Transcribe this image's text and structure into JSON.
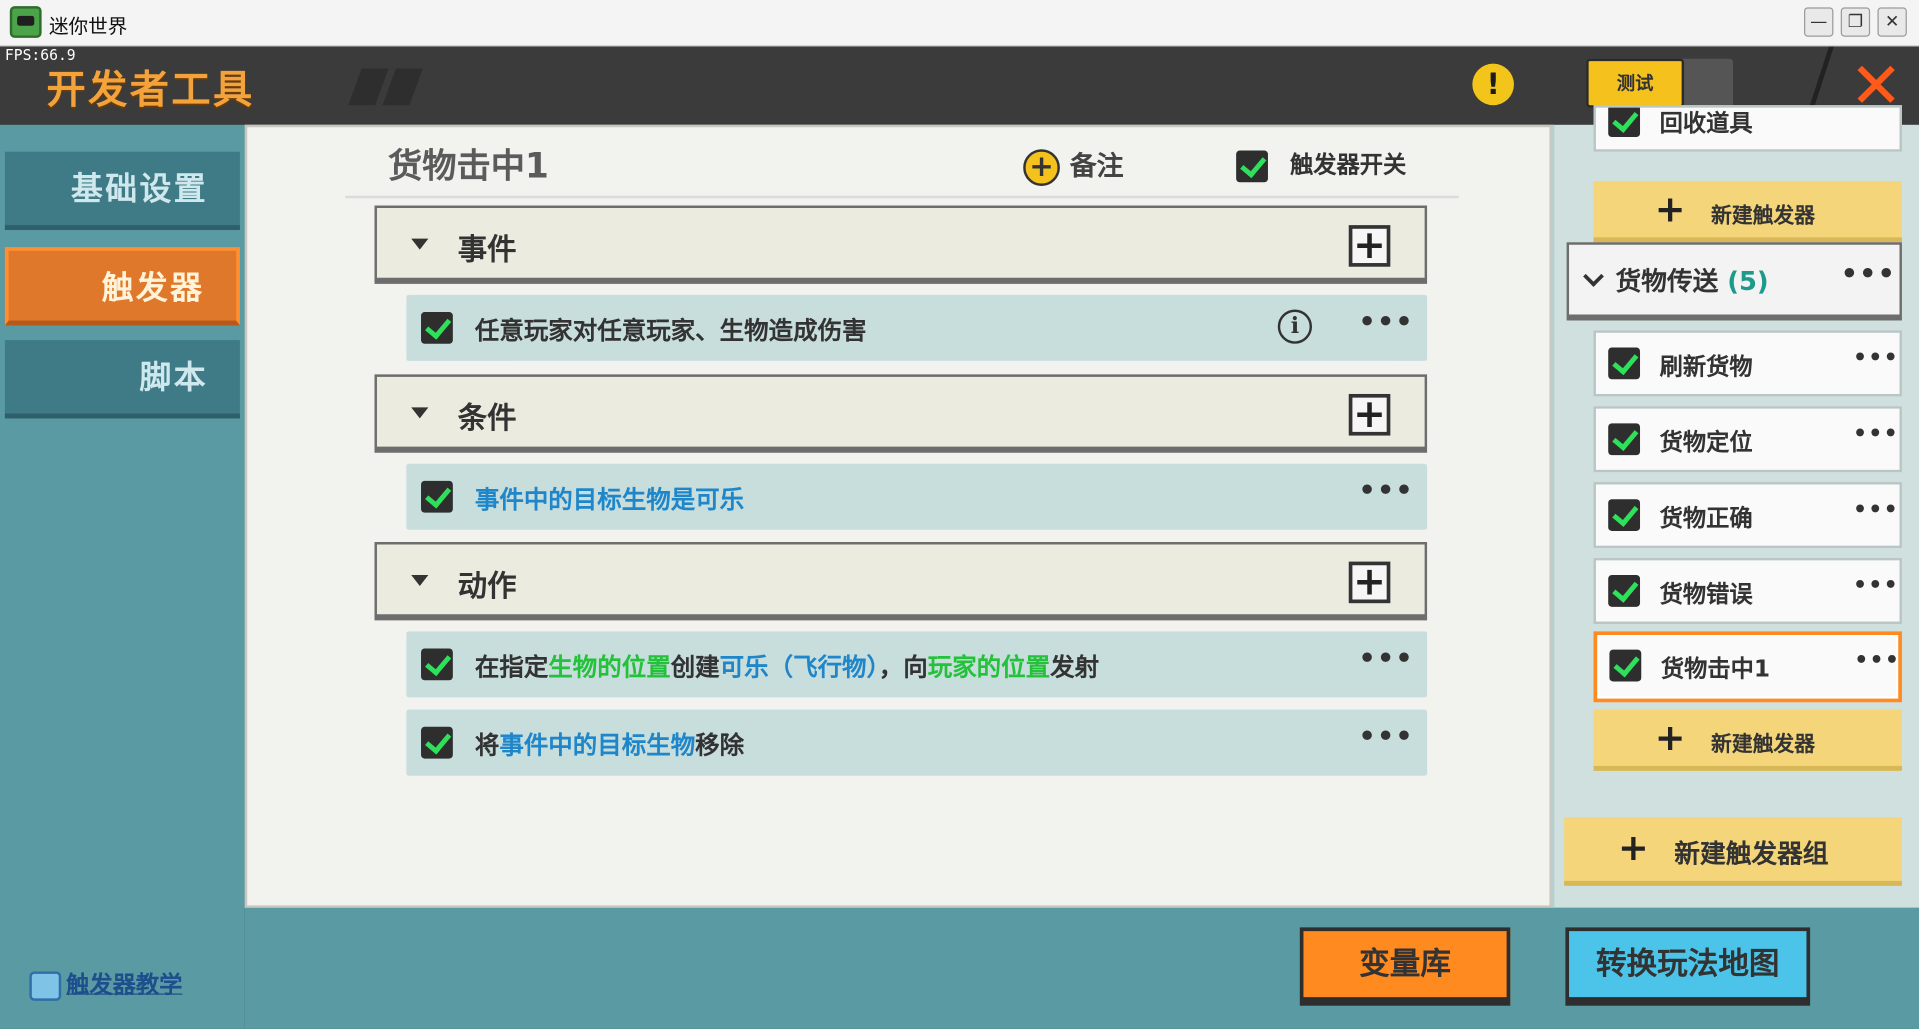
{
  "window": {
    "title": "迷你世界",
    "fps": "FPS:66.9",
    "btn_min": "—",
    "btn_max": "❐",
    "btn_close": "✕"
  },
  "header": {
    "title": "开发者工具",
    "warning_symbol": "!",
    "test_label": "测试",
    "close_symbol": "✕"
  },
  "sidebar": {
    "items": [
      {
        "label": "基础设置"
      },
      {
        "label": "触发器"
      },
      {
        "label": "脚本"
      }
    ],
    "help_link": "触发器教学"
  },
  "editor": {
    "trigger_name": "货物击中1",
    "note_label": "备注",
    "note_plus": "+",
    "switch_label": "触发器开关",
    "sections": {
      "event": {
        "label": "事件",
        "add": "+",
        "rows": [
          {
            "text": "任意玩家对任意玩家、生物造成伤害"
          }
        ]
      },
      "condition": {
        "label": "条件",
        "add": "+",
        "rows": [
          {
            "text": "事件中的目标生物是可乐"
          }
        ]
      },
      "action": {
        "label": "动作",
        "add": "+",
        "rows": [
          {
            "p1": "在指定",
            "p2": "生物的位置",
            "p3": "创建",
            "p4": "可乐（飞行物）",
            "p5": "，向",
            "p6": "玩家的位置",
            "p7": "发射"
          },
          {
            "p1": "将",
            "p2": "事件中的目标生物",
            "p3": "移除"
          }
        ]
      }
    },
    "more": "•••",
    "info": "i"
  },
  "right_panel": {
    "partial_top_label": "回收道具",
    "new_trigger_label": "新建触发器",
    "new_trigger_plus": "+",
    "group": {
      "name": "货物传送",
      "count": "(5)"
    },
    "triggers": [
      {
        "label": "刷新货物"
      },
      {
        "label": "货物定位"
      },
      {
        "label": "货物正确"
      },
      {
        "label": "货物错误"
      },
      {
        "label": "货物击中1"
      }
    ],
    "new_group_label": "新建触发器组",
    "more": "•••"
  },
  "footer": {
    "variable_library": "变量库",
    "convert_map": "转换玩法地图"
  }
}
